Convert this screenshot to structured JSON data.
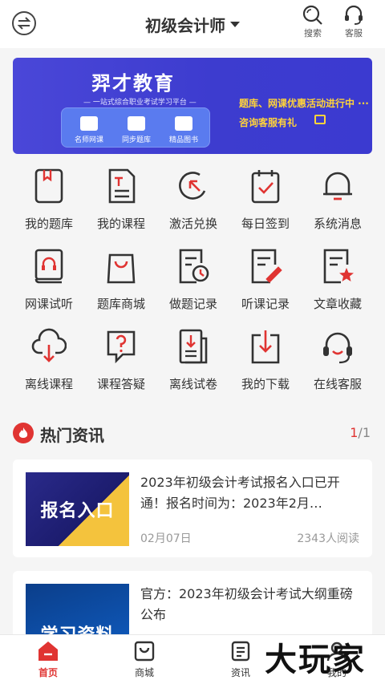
{
  "header": {
    "title": "初级会计师",
    "search_label": "搜索",
    "service_label": "客服"
  },
  "banner": {
    "brand": "羿才教育",
    "subtitle": "— 一站式综合职业考试学习平台 —",
    "items": [
      "名师网课",
      "同步题库",
      "精品图书"
    ],
    "promo_line1": "题库、网课优惠活动进行中 ···",
    "promo_line2": "咨询客服有礼"
  },
  "grid": [
    {
      "label": "我的题库",
      "icon": "book-mark-icon"
    },
    {
      "label": "我的课程",
      "icon": "document-icon"
    },
    {
      "label": "激活兑换",
      "icon": "activate-icon"
    },
    {
      "label": "每日签到",
      "icon": "checkin-icon"
    },
    {
      "label": "系统消息",
      "icon": "bell-icon"
    },
    {
      "label": "网课试听",
      "icon": "headphone-book-icon"
    },
    {
      "label": "题库商城",
      "icon": "shopping-bag-icon"
    },
    {
      "label": "做题记录",
      "icon": "clock-record-icon"
    },
    {
      "label": "听课记录",
      "icon": "edit-record-icon"
    },
    {
      "label": "文章收藏",
      "icon": "star-doc-icon"
    },
    {
      "label": "离线课程",
      "icon": "cloud-download-icon"
    },
    {
      "label": "课程答疑",
      "icon": "question-icon"
    },
    {
      "label": "离线试卷",
      "icon": "paper-download-icon"
    },
    {
      "label": "我的下载",
      "icon": "download-icon"
    },
    {
      "label": "在线客服",
      "icon": "customer-service-icon"
    }
  ],
  "news": {
    "title": "热门资讯",
    "page_current": "1",
    "page_total": "/1",
    "items": [
      {
        "thumb_text": "报名入口",
        "title": "2023年初级会计考试报名入口已开通！报名时间为：2023年2月…",
        "date": "02月07日",
        "views": "2343人阅读"
      },
      {
        "thumb_text": "学习资料",
        "title": "官方：2023年初级会计考试大纲重磅公布",
        "date": "",
        "views": ""
      }
    ]
  },
  "tabbar": {
    "tabs": [
      "首页",
      "商城",
      "资讯",
      "我的"
    ],
    "active_color": "#e03432"
  },
  "watermark": "大玩家",
  "colors": {
    "accent": "#e03432",
    "banner": "#3f3dd1",
    "promo": "#ffd33a"
  }
}
